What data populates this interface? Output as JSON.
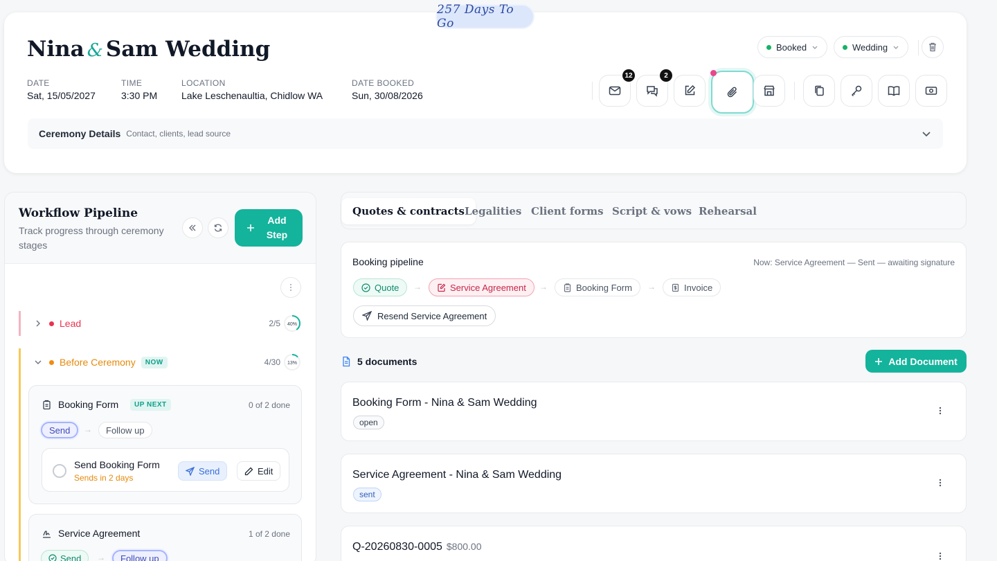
{
  "countdown": "257 Days To Go",
  "event": {
    "name_left": "Nina",
    "amp": "&",
    "name_right": "Sam Wedding",
    "status": "Booked",
    "type": "Wedding",
    "date_label": "DATE",
    "date": "Sat, 15/05/2027",
    "time_label": "TIME",
    "time": "3:30 PM",
    "location_label": "LOCATION",
    "location": "Lake Leschenaultia, Chidlow WA",
    "booked_label": "DATE BOOKED",
    "booked": "Sun, 30/08/2026"
  },
  "toolbar": {
    "email_count": "12",
    "chat_count": "2"
  },
  "ceremony_bar": {
    "title": "Ceremony Details",
    "subtitle": "Contact, clients, lead source"
  },
  "workflow": {
    "title": "Workflow Pipeline",
    "subtitle": "Track progress through ceremony stages",
    "add_step": "Add Step",
    "stages": [
      {
        "name": "Lead",
        "count": "2/5",
        "pct": "40%",
        "fraction": 0.4,
        "color": "#e8334f"
      },
      {
        "name": "Before Ceremony",
        "tag": "NOW",
        "count": "4/30",
        "pct": "13%",
        "fraction": 0.13,
        "color": "#f08c0f"
      }
    ],
    "tasks": [
      {
        "title": "Booking Form",
        "tag": "UP NEXT",
        "done": "0 of 2 done",
        "steps": [
          "Send",
          "Follow up"
        ],
        "subtask": {
          "name": "Send Booking Form",
          "when": "Sends in 2 days",
          "send": "Send",
          "edit": "Edit"
        }
      },
      {
        "title": "Service Agreement",
        "done": "1 of 2 done",
        "steps": [
          "Send",
          "Follow up"
        ]
      }
    ]
  },
  "tabs": [
    "Quotes & contracts",
    "Legalities",
    "Client forms",
    "Script & vows",
    "Rehearsal"
  ],
  "pipeline": {
    "title": "Booking pipeline",
    "now": "Now: Service Agreement — Sent — awaiting signature",
    "steps": [
      "Quote",
      "Service Agreement",
      "Booking Form",
      "Invoice"
    ],
    "resend": "Resend Service Agreement"
  },
  "documents": {
    "count_label": "5 documents",
    "add_label": "Add Document",
    "items": [
      {
        "title": "Booking Form - Nina & Sam Wedding",
        "status": "open"
      },
      {
        "title": "Service Agreement - Nina & Sam Wedding",
        "status": "sent"
      },
      {
        "title": "Q-20260830-0005",
        "price": "$800.00"
      }
    ]
  },
  "colors": {
    "accent": "#14b39c",
    "lead": "#e8334f",
    "before": "#f08c0f"
  }
}
